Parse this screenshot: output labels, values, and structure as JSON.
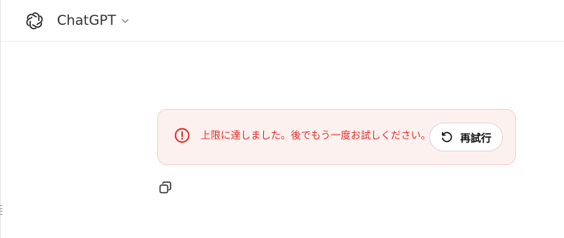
{
  "header": {
    "model_name": "ChatGPT",
    "logo_icon": "openai-logo-icon",
    "chevron_icon": "chevron-down-icon"
  },
  "error": {
    "message": "上限に達しました。後でもう一度お試しください。",
    "icon": "alert-circle-icon",
    "retry_label": "再試行",
    "retry_icon": "rotate-ccw-icon"
  },
  "actions": {
    "copy_icon": "copy-icon"
  },
  "colors": {
    "error_text": "#e02e2a",
    "error_background": "#fdf1ef",
    "error_border": "#f6cfcb",
    "header_border": "#ececec"
  }
}
